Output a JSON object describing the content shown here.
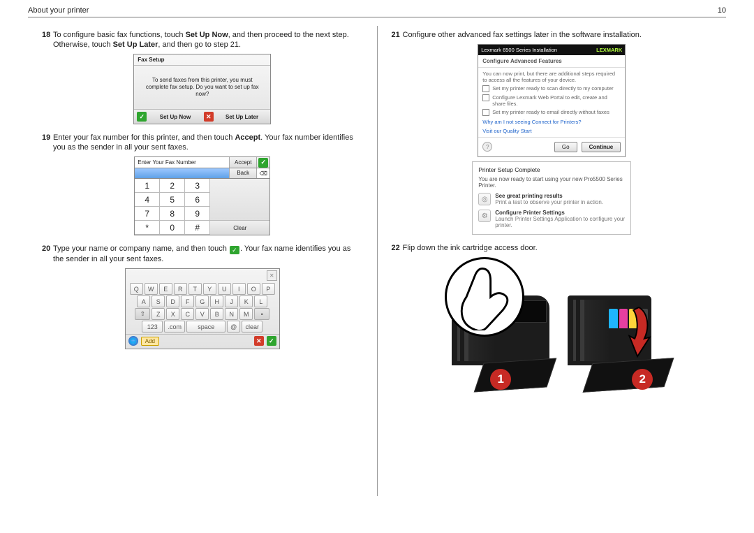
{
  "header": {
    "title": "About your printer",
    "page_no": "10"
  },
  "steps": {
    "s18": {
      "num": "18",
      "pre": "To configure basic fax functions, touch ",
      "b1": "Set Up Now",
      "mid": ", and then proceed to the next step. Otherwise, touch ",
      "b2": "Set Up Later",
      "post": ", and then go to step 21."
    },
    "s19": {
      "num": "19",
      "pre": "Enter your fax number for this printer, and then touch ",
      "b1": "Accept",
      "post": ". Your fax number identifies you as the sender in all your sent faxes."
    },
    "s20": {
      "num": "20",
      "pre": "Type your name or company name, and then touch ",
      "post": ". Your fax name identifies you as the sender in all your sent faxes."
    },
    "s21": {
      "num": "21",
      "txt": "Configure other advanced fax settings later in the software installation."
    },
    "s22": {
      "num": "22",
      "txt": "Flip down the ink cartridge access door."
    }
  },
  "fax_panel": {
    "title": "Fax Setup",
    "body": "To send faxes from this printer, you must complete fax setup. Do you want to set up fax now?",
    "btn_now": "Set Up Now",
    "btn_later": "Set Up Later"
  },
  "keypad": {
    "input_label": "Enter Your Fax Number",
    "accept": "Accept",
    "back": "Back",
    "clear": "Clear",
    "keys": [
      "1",
      "2",
      "3",
      "4",
      "5",
      "6",
      "7",
      "8",
      "9",
      "*",
      "0",
      "#"
    ]
  },
  "keyboard": {
    "rows": [
      [
        "Q",
        "W",
        "E",
        "R",
        "T",
        "Y",
        "U",
        "I",
        "O",
        "P"
      ],
      [
        "A",
        "S",
        "D",
        "F",
        "G",
        "H",
        "J",
        "K",
        "L"
      ],
      [
        "⇧",
        "Z",
        "X",
        "C",
        "V",
        "B",
        "N",
        "M",
        "•"
      ]
    ],
    "bottom": {
      "num": "123",
      "com": ".com",
      "space": "space",
      "at": "@",
      "clear": "clear"
    },
    "add": "Add"
  },
  "software": {
    "window_title": "Lexmark 6500 Series Installation",
    "brand": "LEXMARK",
    "subtitle": "Configure Advanced Features",
    "lead": "You can now print, but there are additional steps required to access all the features of your device.",
    "opts": [
      "Set my printer ready to scan directly to my computer",
      "Configure Lexmark Web Portal to edit, create and share files.",
      "Set my printer ready to email directly without faxes"
    ],
    "link1": "Why am I not seeing Connect for Printers?",
    "link2": "Visit our Quality Start",
    "btn_go": "Go",
    "btn_continue": "Continue"
  },
  "psc": {
    "title": "Printer Setup Complete",
    "lead": "You are now ready to start using your new Pro5500 Series Printer.",
    "rows": [
      {
        "t1": "See great printing results",
        "t2": "Print a test to observe your printer in action."
      },
      {
        "t1": "Configure Printer Settings",
        "t2": "Launch Printer Settings Application to configure your printer."
      }
    ]
  },
  "badges": {
    "b1": "1",
    "b2": "2"
  }
}
